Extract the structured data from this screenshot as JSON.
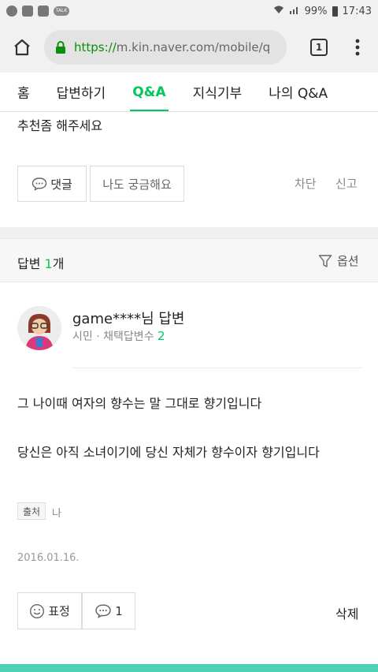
{
  "status_bar": {
    "talk_badge": "TALK",
    "battery": "99%",
    "time": "17:43"
  },
  "browser": {
    "url_scheme": "https://",
    "url_rest": "m.kin.naver.com/mobile/q",
    "tab_count": "1"
  },
  "nav": {
    "tabs": [
      "홈",
      "답변하기",
      "Q&A",
      "지식기부",
      "나의 Q&A"
    ],
    "active": "Q&A"
  },
  "question": {
    "text_tail": "추천좀 해주세요",
    "comment_label": "댓글",
    "curious_label": "나도 궁금해요",
    "block_label": "차단",
    "report_label": "신고"
  },
  "answers_header": {
    "prefix": "답변",
    "count": "1",
    "suffix": "개",
    "options_label": "옵션"
  },
  "answer": {
    "user": "game****님 답변",
    "level": "시민",
    "adopted_label": "· 채택답변수",
    "adopted_count": "2",
    "body": [
      "그 나이때 여자의 향수는 말 그대로 향기입니다",
      "당신은 아직 소녀이기에 당신 자체가 향수이자 향기입니다"
    ],
    "source_tag": "출처",
    "source_value": "나",
    "date": "2016.01.16.",
    "reaction_label": "표정",
    "reply_count": "1",
    "delete_label": "삭제"
  },
  "colors": {
    "accent": "#03c75a",
    "url_scheme": "#0a8f08",
    "bottom_strip": "#4fd1b5"
  }
}
